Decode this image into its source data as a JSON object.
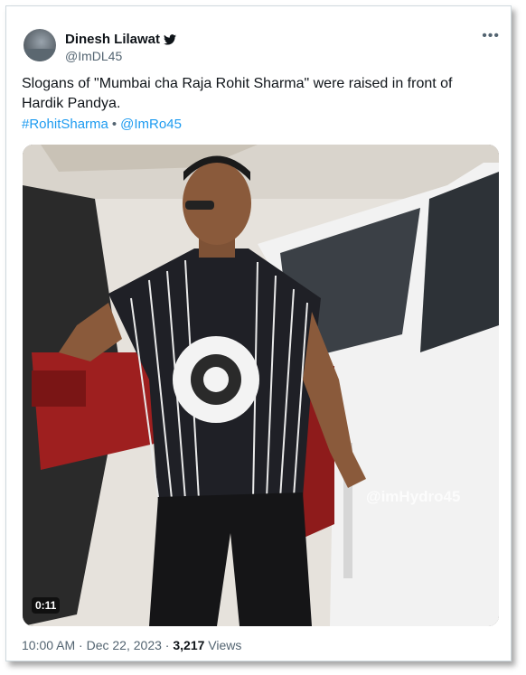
{
  "author": {
    "name": "Dinesh Lilawat",
    "handle": "@ImDL45"
  },
  "tweet": {
    "text": "Slogans of \"Mumbai cha Raja Rohit Sharma\" were raised in front of Hardik Pandya.",
    "hashtag": "#RohitSharma",
    "separator": "•",
    "mention": "@ImRo45"
  },
  "video": {
    "duration": "0:11",
    "watermark": "@imHydro45"
  },
  "meta": {
    "time": "10:00 AM",
    "sep": "·",
    "date": "Dec 22, 2023",
    "views_count": "3,217",
    "views_label": "Views"
  },
  "icons": {
    "verified": "twitter-bird-icon",
    "more": "more-options-icon"
  },
  "colors": {
    "link": "#1d9bf0",
    "secondary": "#536471"
  }
}
